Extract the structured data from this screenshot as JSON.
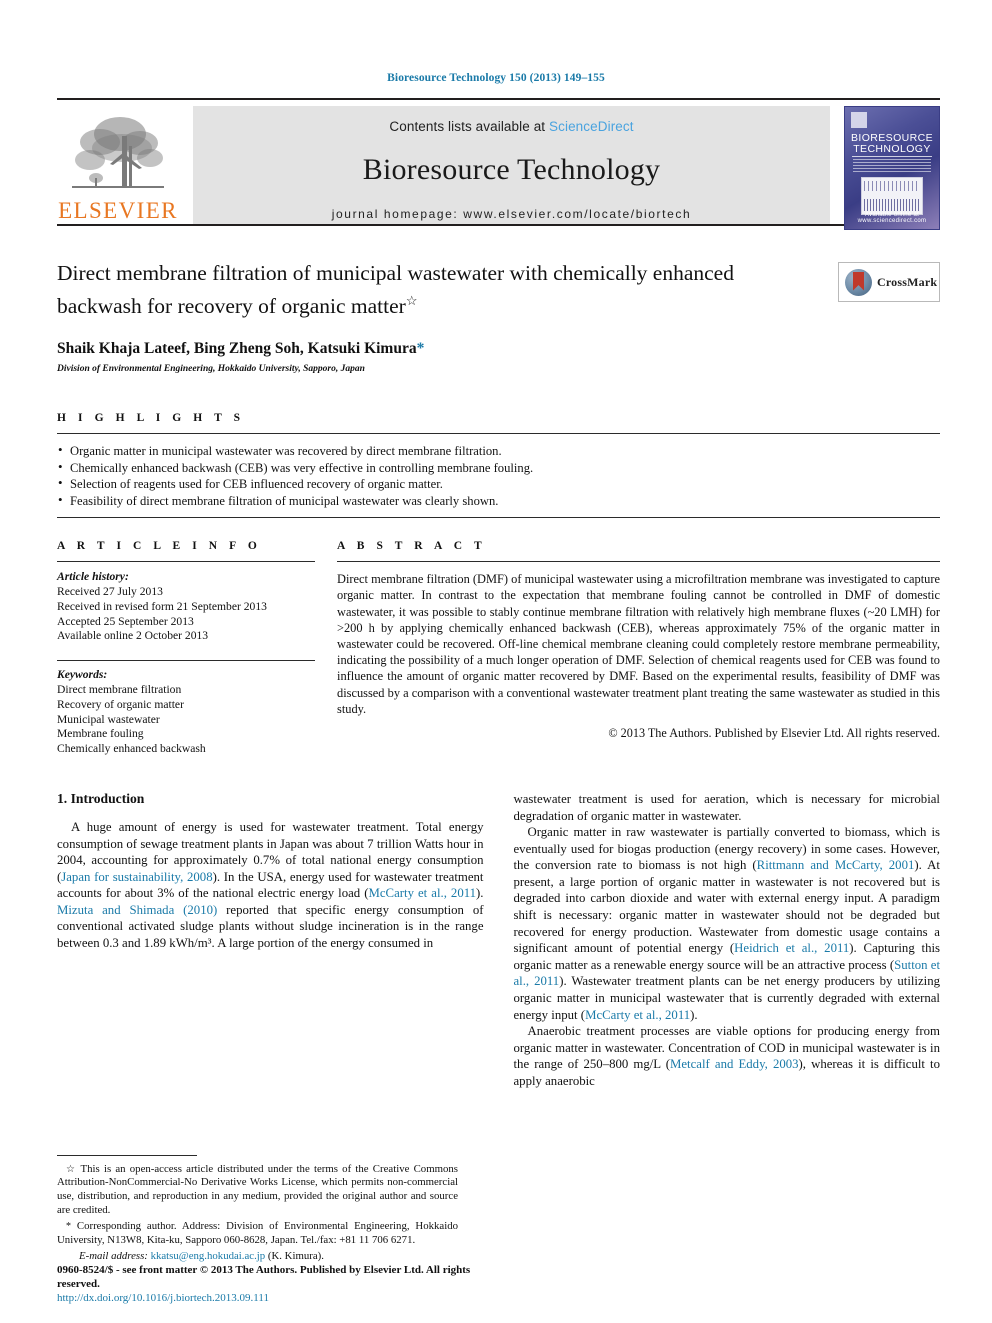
{
  "running_head": "Bioresource Technology 150 (2013) 149–155",
  "masthead": {
    "publisher_name": "ELSEVIER",
    "publisher_logo_icon": "elsevier-tree-icon",
    "contents_prefix": "Contents lists available at ",
    "contents_link": "ScienceDirect",
    "journal_title": "Bioresource Technology",
    "homepage_line": "journal homepage: www.elsevier.com/locate/biortech",
    "cover": {
      "title_line1": "BIORESOURCE",
      "title_line2": "TECHNOLOGY",
      "footer_text": "Available online at www.sciencedirect.com"
    }
  },
  "article": {
    "title": "Direct membrane filtration of municipal wastewater with chemically enhanced backwash for recovery of organic matter",
    "title_footnote_mark": "☆",
    "authors": "Shaik Khaja Lateef, Bing Zheng Soh, Katsuki Kimura",
    "corresponding_mark": "*",
    "affiliation": "Division of Environmental Engineering, Hokkaido University, Sapporo, Japan",
    "crossmark_label": "CrossMark"
  },
  "highlights": {
    "heading": "H I G H L I G H T S",
    "items": [
      "Organic matter in municipal wastewater was recovered by direct membrane filtration.",
      "Chemically enhanced backwash (CEB) was very effective in controlling membrane fouling.",
      "Selection of reagents used for CEB influenced recovery of organic matter.",
      "Feasibility of direct membrane filtration of municipal wastewater was clearly shown."
    ]
  },
  "article_info": {
    "heading": "A R T I C L E    I N F O",
    "history_label": "Article history:",
    "history": [
      "Received 27 July 2013",
      "Received in revised form 21 September 2013",
      "Accepted 25 September 2013",
      "Available online 2 October 2013"
    ],
    "keywords_label": "Keywords:",
    "keywords": [
      "Direct membrane filtration",
      "Recovery of organic matter",
      "Municipal wastewater",
      "Membrane fouling",
      "Chemically enhanced backwash"
    ]
  },
  "abstract": {
    "heading": "A B S T R A C T",
    "text": "Direct membrane filtration (DMF) of municipal wastewater using a microfiltration membrane was investigated to capture organic matter. In contrast to the expectation that membrane fouling cannot be controlled in DMF of domestic wastewater, it was possible to stably continue membrane filtration with relatively high membrane fluxes (~20 LMH) for >200 h by applying chemically enhanced backwash (CEB), whereas approximately 75% of the organic matter in wastewater could be recovered. Off-line chemical membrane cleaning could completely restore membrane permeability, indicating the possibility of a much longer operation of DMF. Selection of chemical reagents used for CEB was found to influence the amount of organic matter recovered by DMF. Based on the experimental results, feasibility of DMF was discussed by a comparison with a conventional wastewater treatment plant treating the same wastewater as studied in this study.",
    "copyright": "© 2013 The Authors. Published by Elsevier Ltd. All rights reserved."
  },
  "body": {
    "section_title": "1. Introduction",
    "left_paragraphs": [
      {
        "parts": [
          {
            "t": "A huge amount of energy is used for wastewater treatment. Total energy consumption of sewage treatment plants in Japan was about 7 trillion Watts hour in 2004, accounting for approximately 0.7% of total national energy consumption (",
            "ref": false
          },
          {
            "t": "Japan for sustainability, 2008",
            "ref": true
          },
          {
            "t": "). In the USA, energy used for wastewater treatment accounts for about 3% of the national electric energy load (",
            "ref": false
          },
          {
            "t": "McCarty et al., 2011",
            "ref": true
          },
          {
            "t": "). ",
            "ref": false
          },
          {
            "t": "Mizuta and Shimada (2010)",
            "ref": true
          },
          {
            "t": " reported that specific energy consumption of conventional activated sludge plants without sludge incineration is in the range between 0.3 and 1.89 kWh/m³. A large portion of the energy consumed in",
            "ref": false
          }
        ]
      }
    ],
    "right_paragraphs": [
      {
        "parts": [
          {
            "t": "wastewater treatment is used for aeration, which is necessary for microbial degradation of organic matter in wastewater.",
            "ref": false
          }
        ],
        "continuation": true
      },
      {
        "parts": [
          {
            "t": "Organic matter in raw wastewater is partially converted to biomass, which is eventually used for biogas production (energy recovery) in some cases. However, the conversion rate to biomass is not high (",
            "ref": false
          },
          {
            "t": "Rittmann and McCarty, 2001",
            "ref": true
          },
          {
            "t": "). At present, a large portion of organic matter in wastewater is not recovered but is degraded into carbon dioxide and water with external energy input. A paradigm shift is necessary: organic matter in wastewater should not be degraded but recovered for energy production. Wastewater from domestic usage contains a significant amount of potential energy (",
            "ref": false
          },
          {
            "t": "Heidrich et al., 2011",
            "ref": true
          },
          {
            "t": "). Capturing this organic matter as a renewable energy source will be an attractive process (",
            "ref": false
          },
          {
            "t": "Sutton et al., 2011",
            "ref": true
          },
          {
            "t": "). Wastewater treatment plants can be net energy producers by utilizing organic matter in municipal wastewater that is currently degraded with external energy input (",
            "ref": false
          },
          {
            "t": "McCarty et al., 2011",
            "ref": true
          },
          {
            "t": ").",
            "ref": false
          }
        ]
      },
      {
        "parts": [
          {
            "t": "Anaerobic treatment processes are viable options for producing energy from organic matter in wastewater. Concentration of COD in municipal wastewater is in the range of 250–800 mg/L (",
            "ref": false
          },
          {
            "t": "Metcalf and Eddy, 2003",
            "ref": true
          },
          {
            "t": "), whereas it is difficult to apply anaerobic",
            "ref": false
          }
        ]
      }
    ]
  },
  "footnotes": {
    "license": "This is an open-access article distributed under the terms of the Creative Commons Attribution-NonCommercial-No Derivative Works License, which permits non-commercial use, distribution, and reproduction in any medium, provided the original author and source are credited.",
    "license_mark": "☆",
    "corresponding": "Corresponding author. Address: Division of Environmental Engineering, Hokkaido University, N13W8, Kita-ku, Sapporo 060-8628, Japan. Tel./fax: +81 11 706 6271.",
    "corresponding_mark": "*",
    "email_label": "E-mail address:",
    "email": "kkatsu@eng.hokudai.ac.jp",
    "email_owner": "(K. Kimura)."
  },
  "footer": {
    "issn_line": "0960-8524/$ - see front matter © 2013 The Authors. Published by Elsevier Ltd. All rights reserved.",
    "doi": "http://dx.doi.org/10.1016/j.biortech.2013.09.111"
  },
  "colors": {
    "link_blue": "#1a7aa8",
    "sciencedirect_blue": "#4aa3df",
    "elsevier_orange": "#E87722",
    "banner_grey": "#e3e3e3"
  }
}
